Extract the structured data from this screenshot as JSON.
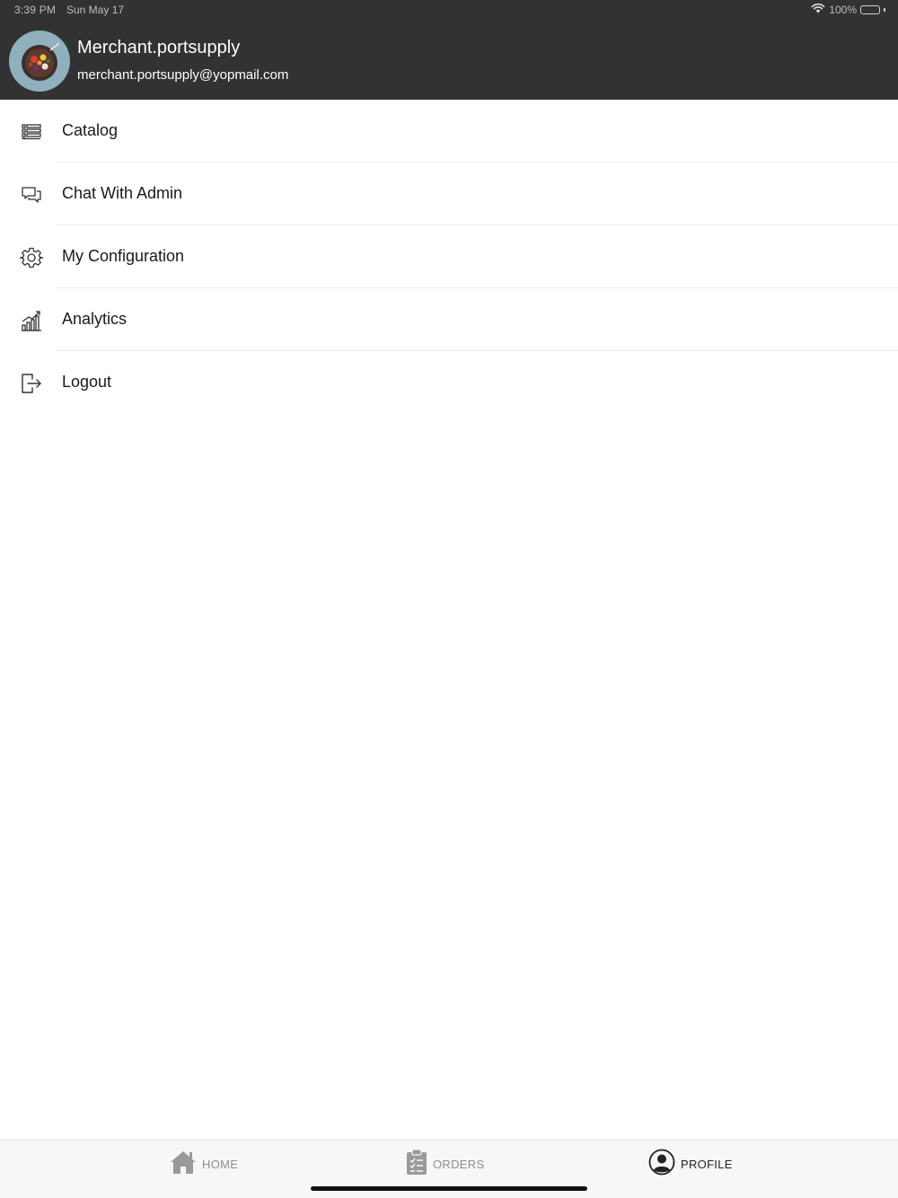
{
  "status_bar": {
    "time": "3:39 PM",
    "date": "Sun May 17",
    "battery": "100%",
    "icons": [
      "wifi-icon",
      "battery-icon"
    ]
  },
  "profile": {
    "name": "Merchant.portsupply",
    "email": "merchant.portsupply@yopmail.com",
    "avatar": "food-avatar"
  },
  "menu": {
    "items": [
      {
        "label": "Catalog",
        "icon": "list-icon"
      },
      {
        "label": "Chat With Admin",
        "icon": "chat-icon"
      },
      {
        "label": "My Configuration",
        "icon": "gear-icon"
      },
      {
        "label": "Analytics",
        "icon": "analytics-icon"
      },
      {
        "label": "Logout",
        "icon": "logout-icon"
      }
    ]
  },
  "tabbar": {
    "tabs": [
      {
        "label": "HOME",
        "icon": "home-icon",
        "active": false
      },
      {
        "label": "ORDERS",
        "icon": "clipboard-icon",
        "active": false
      },
      {
        "label": "PROFILE",
        "icon": "user-circle-icon",
        "active": true
      }
    ]
  },
  "colors": {
    "header_bg": "#323232",
    "tab_inactive": "#8e8e8e",
    "tab_active": "#222222",
    "menu_text": "#1a1a1a"
  }
}
